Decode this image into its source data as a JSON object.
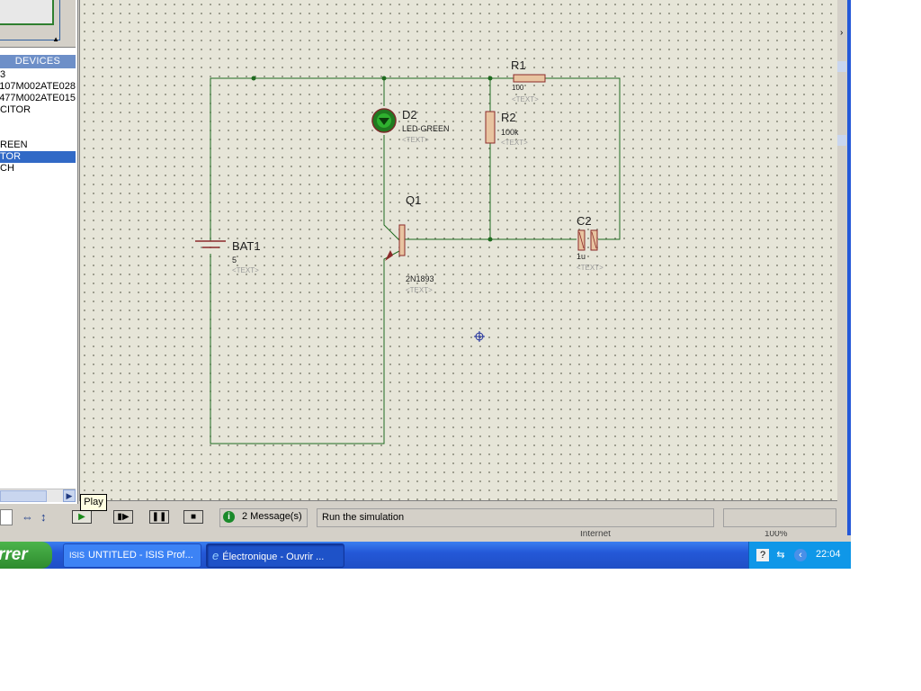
{
  "left_panel": {
    "devices_header": "DEVICES",
    "devices": [
      {
        "label": "3"
      },
      {
        "label": "107M002ATE028"
      },
      {
        "label": "477M002ATE015"
      },
      {
        "label": "CITOR"
      },
      {
        "label": ""
      },
      {
        "label": ""
      },
      {
        "label": "REEN"
      },
      {
        "label": "TOR",
        "selected": true
      },
      {
        "label": "CH"
      }
    ]
  },
  "schematic": {
    "bat1": {
      "ref": "BAT1",
      "value": "5",
      "text": "<TEXT>"
    },
    "d2": {
      "ref": "D2",
      "value": "LED-GREEN",
      "text": "<TEXT>"
    },
    "r1": {
      "ref": "R1",
      "value": "100",
      "text": "<TEXT>"
    },
    "r2": {
      "ref": "R2",
      "value": "100k",
      "text": "<TEXT>"
    },
    "q1": {
      "ref": "Q1",
      "value": "2N1893",
      "text": "<TEXT>"
    },
    "c2": {
      "ref": "C2",
      "value": "1u",
      "text": "<TEXT>"
    }
  },
  "bottom_bar": {
    "play_tooltip": "Play",
    "messages": "2 Message(s)",
    "status": "Run the simulation"
  },
  "behind_window": {
    "internet_label": "Internet",
    "zoom_label": "100%"
  },
  "taskbar": {
    "start_label": "rrer",
    "tasks": [
      {
        "icon": "ISIS",
        "label": "UNTITLED - ISIS Prof..."
      },
      {
        "icon": "e",
        "label": "Électronique - Ouvrir ..."
      }
    ],
    "clock": "22:04"
  }
}
